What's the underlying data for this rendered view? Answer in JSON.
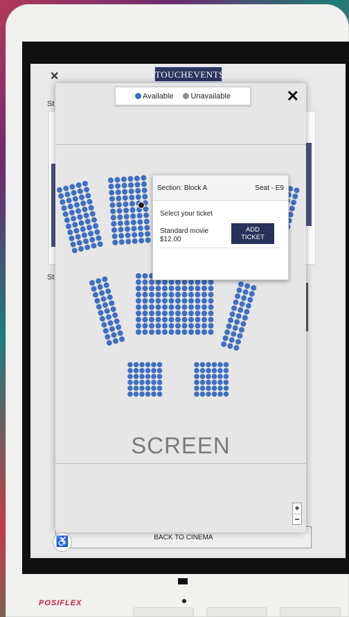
{
  "app": {
    "logo_text": "TOUCHEVENTS",
    "bg_label_1": "St",
    "bg_label_2": "St",
    "back_button": "BACK TO CINEMA"
  },
  "legend": {
    "available": "Available",
    "unavailable": "Unavailable",
    "available_color": "#3f6fbf",
    "unavailable_color": "#8e8e8e"
  },
  "screen_label": "SCREEN",
  "zoom": {
    "in": "+",
    "out": "−"
  },
  "popup": {
    "section": "Section: Block A",
    "seat": "Seat - E9",
    "subtitle": "Select your ticket",
    "ticket_name": "Standard movie",
    "ticket_price": "$12.00",
    "add_button": "ADD TICKET"
  },
  "device": {
    "brand": "POSIFLEX"
  },
  "icons": {
    "close": "close-icon",
    "wheelchair": "wheelchair-icon"
  }
}
